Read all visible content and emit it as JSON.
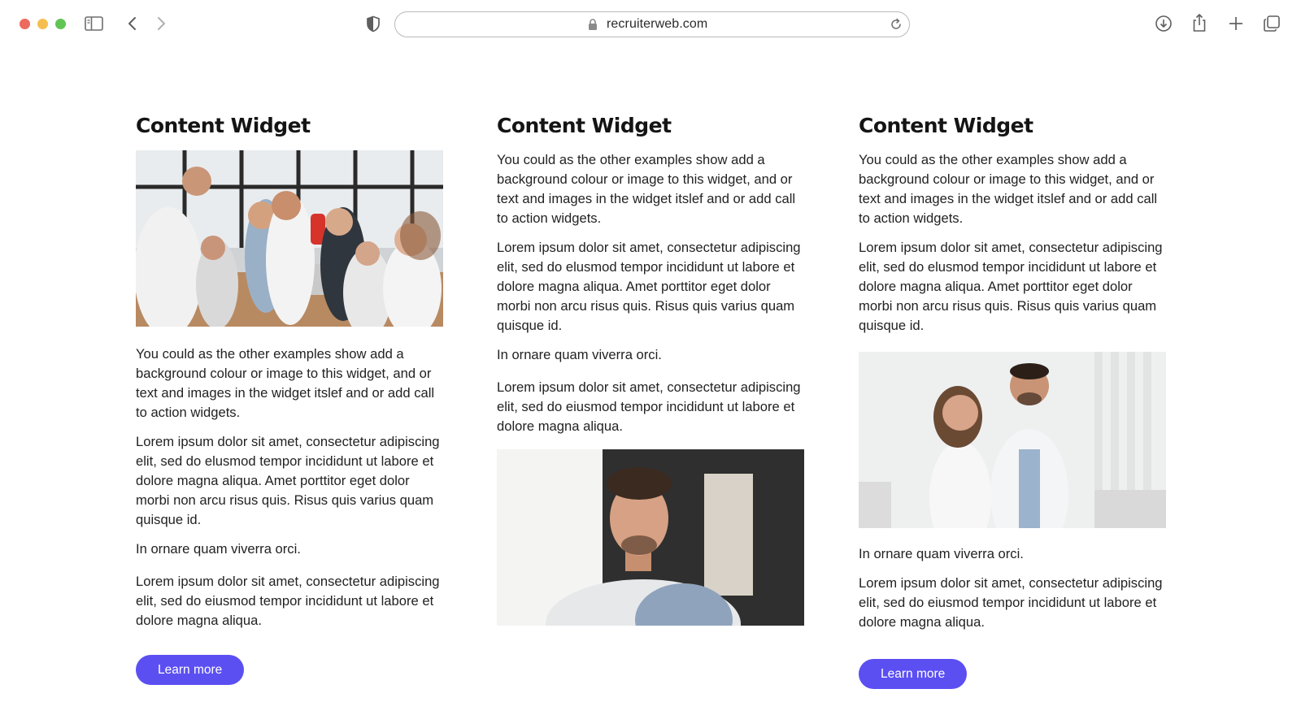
{
  "browser": {
    "url": "recruiterweb.com",
    "icons": [
      "sidebar-toggle-icon",
      "back-chevron-icon",
      "forward-chevron-icon",
      "shield-icon",
      "lock-icon",
      "reload-icon",
      "download-icon",
      "share-icon",
      "new-tab-plus-icon",
      "tab-overview-icon"
    ]
  },
  "columns": [
    {
      "title": "Content Widget",
      "image": "team-celebrating-office-photo",
      "paragraphs": [
        "You could as the other examples show add a background colour or image to this widget, and or text and images in the widget itslef and or add call to action widgets.",
        "Lorem ipsum dolor sit amet, consectetur adipiscing elit, sed do elusmod tempor incididunt ut labore et dolore magna aliqua. Amet porttitor eget dolor morbi non arcu risus quis. Risus quis varius quam quisque id.",
        "In ornare quam viverra orci.",
        "Lorem ipsum dolor sit amet, consectetur adipiscing elit, sed do eiusmod tempor incididunt ut labore et dolore magna aliqua."
      ],
      "button": "Learn more"
    },
    {
      "title": "Content Widget",
      "image": "young-man-portrait-photo",
      "paragraphs": [
        "You could as the other examples show add a background colour or image to this widget, and or text and images in the widget itslef and or add call to action widgets.",
        "Lorem ipsum dolor sit amet, consectetur adipiscing elit, sed do elusmod tempor incididunt ut labore et dolore magna aliqua. Amet porttitor eget dolor morbi non arcu risus quis. Risus quis varius quam quisque id.",
        "In ornare quam viverra orci.",
        "Lorem ipsum dolor sit amet, consectetur adipiscing elit, sed do eiusmod tempor incididunt ut labore et dolore magna aliqua."
      ]
    },
    {
      "title": "Content Widget",
      "image": "doctors-clinic-photo",
      "paragraphs": [
        "You could as the other examples show add a background colour or image to this widget, and or text and images in the widget itslef and or add call to action widgets.",
        "Lorem ipsum dolor sit amet, consectetur adipiscing elit, sed do elusmod tempor incididunt ut labore et dolore magna aliqua. Amet porttitor eget dolor morbi non arcu risus quis. Risus quis varius quam quisque id.",
        "In ornare quam viverra orci.",
        "Lorem ipsum dolor sit amet, consectetur adipiscing elit, sed do eiusmod tempor incididunt ut labore et dolore magna aliqua."
      ],
      "button": "Learn more"
    }
  ],
  "colors": {
    "accent": "#5b4ff2",
    "text": "#222222",
    "heading": "#141414"
  }
}
